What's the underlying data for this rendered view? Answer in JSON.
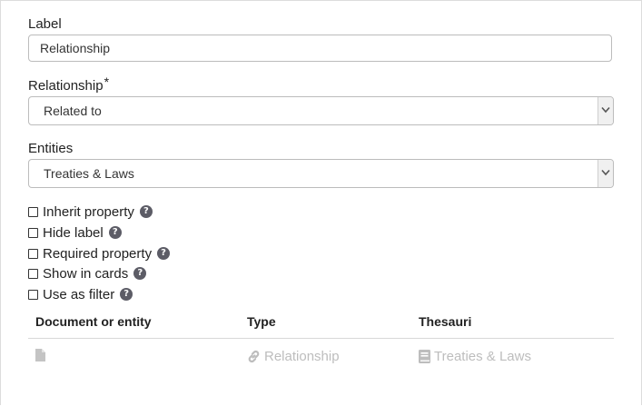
{
  "label_field": {
    "label": "Label",
    "value": "Relationship"
  },
  "relationship_field": {
    "label": "Relationship",
    "required_mark": "*",
    "selected": "Related to"
  },
  "entities_field": {
    "label": "Entities",
    "selected": "Treaties & Laws"
  },
  "options": [
    {
      "label": "Inherit property",
      "checked": false
    },
    {
      "label": "Hide label",
      "checked": false
    },
    {
      "label": "Required property",
      "checked": false
    },
    {
      "label": "Show in cards",
      "checked": false
    },
    {
      "label": "Use as filter",
      "checked": false
    }
  ],
  "table": {
    "headers": [
      "Document or entity",
      "Type",
      "Thesauri"
    ],
    "row": {
      "type": "Relationship",
      "thesauri": "Treaties & Laws"
    },
    "icons": {
      "document": "file-icon",
      "type": "link-icon",
      "thesauri": "book-icon"
    }
  },
  "colors": {
    "help_icon": "#5c5c66",
    "muted_text": "#bdbdbd",
    "border": "#bcbcbc"
  }
}
